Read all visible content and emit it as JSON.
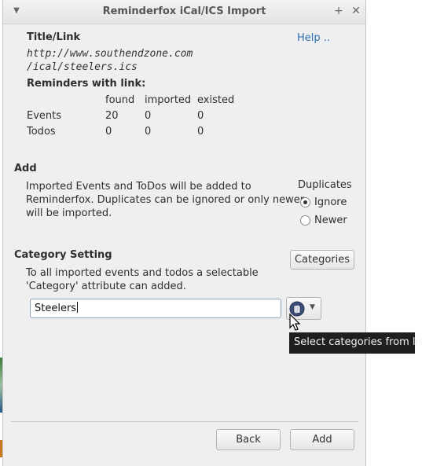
{
  "window": {
    "title": "Reminderfox iCal/ICS Import"
  },
  "header": {
    "title_link_label": "Title/Link",
    "help_link": "Help ..",
    "url_line1": "http://www.southendzone.com",
    "url_line2": "/ical/steelers.ics"
  },
  "reminders": {
    "heading": "Reminders with link:",
    "columns": [
      "found",
      "imported",
      "existed"
    ],
    "rows": [
      {
        "label": "Events",
        "found": "20",
        "imported": "0",
        "existed": "0"
      },
      {
        "label": "Todos",
        "found": "0",
        "imported": "0",
        "existed": "0"
      }
    ]
  },
  "add": {
    "heading": "Add",
    "description_l1": "Imported Events and ToDos will be added to",
    "description_l2": "Reminderfox. Duplicates can be ignored or only newer",
    "description_l3": "will be imported.",
    "duplicates_label": "Duplicates",
    "options": [
      {
        "label": "Ignore",
        "checked": true
      },
      {
        "label": "Newer",
        "checked": false
      }
    ]
  },
  "category": {
    "heading": "Category Setting",
    "categories_button": "Categories",
    "description_l1": "To all imported events and todos a selectable",
    "description_l2": "'Category' attribute can added.",
    "input_value": "Steelers",
    "tooltip": "Select categories from list"
  },
  "footer": {
    "back_label": "Back",
    "add_label": "Add"
  },
  "colors": {
    "accent": "#2a6fb5",
    "dialog_bg": "#efefef"
  }
}
